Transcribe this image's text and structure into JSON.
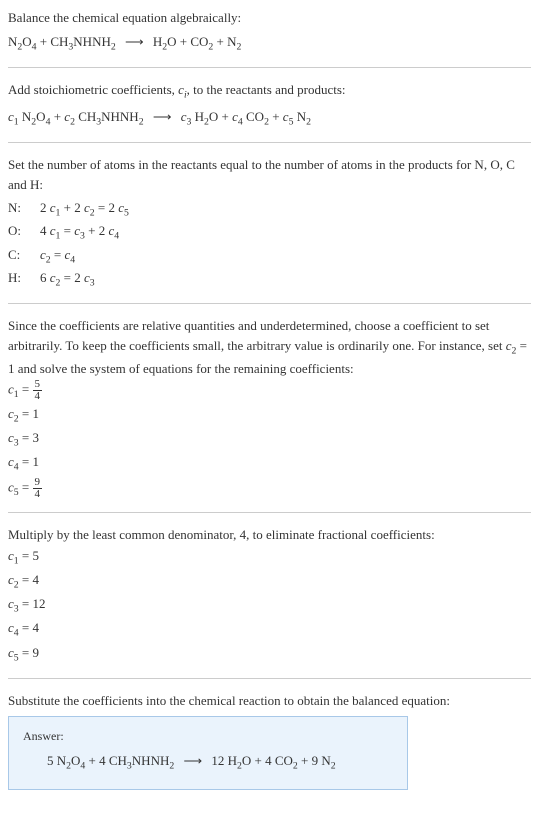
{
  "intro": {
    "title": "Balance the chemical equation algebraically:",
    "equation": "N₂O₄ + CH₃NHNH₂  ⟶  H₂O + CO₂ + N₂"
  },
  "step1": {
    "text": "Add stoichiometric coefficients, cᵢ, to the reactants and products:",
    "equation": "c₁ N₂O₄ + c₂ CH₃NHNH₂  ⟶  c₃ H₂O + c₄ CO₂ + c₅ N₂"
  },
  "step2": {
    "text": "Set the number of atoms in the reactants equal to the number of atoms in the products for N, O, C and H:",
    "rows": [
      {
        "label": "N:",
        "eq": "2 c₁ + 2 c₂ = 2 c₅"
      },
      {
        "label": "O:",
        "eq": "4 c₁ = c₃ + 2 c₄"
      },
      {
        "label": "C:",
        "eq": "c₂ = c₄"
      },
      {
        "label": "H:",
        "eq": "6 c₂ = 2 c₃"
      }
    ]
  },
  "step3": {
    "text": "Since the coefficients are relative quantities and underdetermined, choose a coefficient to set arbitrarily. To keep the coefficients small, the arbitrary value is ordinarily one. For instance, set c₂ = 1 and solve the system of equations for the remaining coefficients:",
    "coeffs": [
      {
        "lhs": "c₁ = ",
        "frac_num": "5",
        "frac_den": "4"
      },
      {
        "lhs": "c₂ = ",
        "val": "1"
      },
      {
        "lhs": "c₃ = ",
        "val": "3"
      },
      {
        "lhs": "c₄ = ",
        "val": "1"
      },
      {
        "lhs": "c₅ = ",
        "frac_num": "9",
        "frac_den": "4"
      }
    ]
  },
  "step4": {
    "text": "Multiply by the least common denominator, 4, to eliminate fractional coefficients:",
    "coeffs": [
      {
        "line": "c₁ = 5"
      },
      {
        "line": "c₂ = 4"
      },
      {
        "line": "c₃ = 12"
      },
      {
        "line": "c₄ = 4"
      },
      {
        "line": "c₅ = 9"
      }
    ]
  },
  "final": {
    "text": "Substitute the coefficients into the chemical reaction to obtain the balanced equation:",
    "answer_label": "Answer:",
    "answer_eq": "5 N₂O₄ + 4 CH₃NHNH₂  ⟶  12 H₂O + 4 CO₂ + 9 N₂"
  }
}
